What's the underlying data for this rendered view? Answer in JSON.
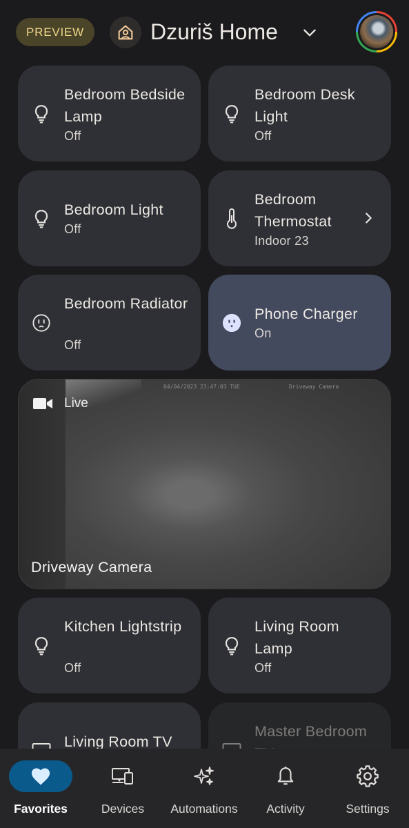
{
  "header": {
    "badge": "PREVIEW",
    "home_name": "Dzuriš Home"
  },
  "tiles": [
    {
      "name": "Bedroom Bedside Lamp",
      "state": "Off",
      "icon": "lightbulb-icon"
    },
    {
      "name": "Bedroom Desk Light",
      "state": "Off",
      "icon": "lightbulb-icon"
    },
    {
      "name": "Bedroom Light",
      "state": "Off",
      "icon": "lightbulb-icon"
    },
    {
      "name": "Bedroom Thermostat",
      "state": "Indoor 23",
      "icon": "thermometer-icon"
    },
    {
      "name": "Bedroom Radiator",
      "state": "Off",
      "icon": "outlet-icon"
    },
    {
      "name": "Phone Charger",
      "state": "On",
      "icon": "outlet-icon"
    },
    {
      "name": "Kitchen Lightstrip",
      "state": "Off",
      "icon": "lightbulb-icon"
    },
    {
      "name": "Living Room Lamp",
      "state": "Off",
      "icon": "lightbulb-icon"
    },
    {
      "name": "Living Room TV",
      "state": "",
      "icon": "tv-icon"
    },
    {
      "name": "Master Bedroom TV",
      "state": "",
      "icon": "tv-icon"
    }
  ],
  "camera": {
    "status": "Live",
    "name": "Driveway Camera",
    "timestamp": "04/04/2023 23:47:03 TUE",
    "overlay_label": "Driveway Camera"
  },
  "nav": [
    {
      "label": "Favorites",
      "icon": "heart-icon",
      "active": true
    },
    {
      "label": "Devices",
      "icon": "devices-icon",
      "active": false
    },
    {
      "label": "Automations",
      "icon": "sparkle-icon",
      "active": false
    },
    {
      "label": "Activity",
      "icon": "bell-icon",
      "active": false
    },
    {
      "label": "Settings",
      "icon": "gear-icon",
      "active": false
    }
  ],
  "colors": {
    "background": "#1b1b1d",
    "tile": "#2e3035",
    "tile_on": "#444a5e",
    "nav_active": "#0b5a8c",
    "badge_bg": "#4a4428",
    "badge_text": "#f1d98c"
  }
}
